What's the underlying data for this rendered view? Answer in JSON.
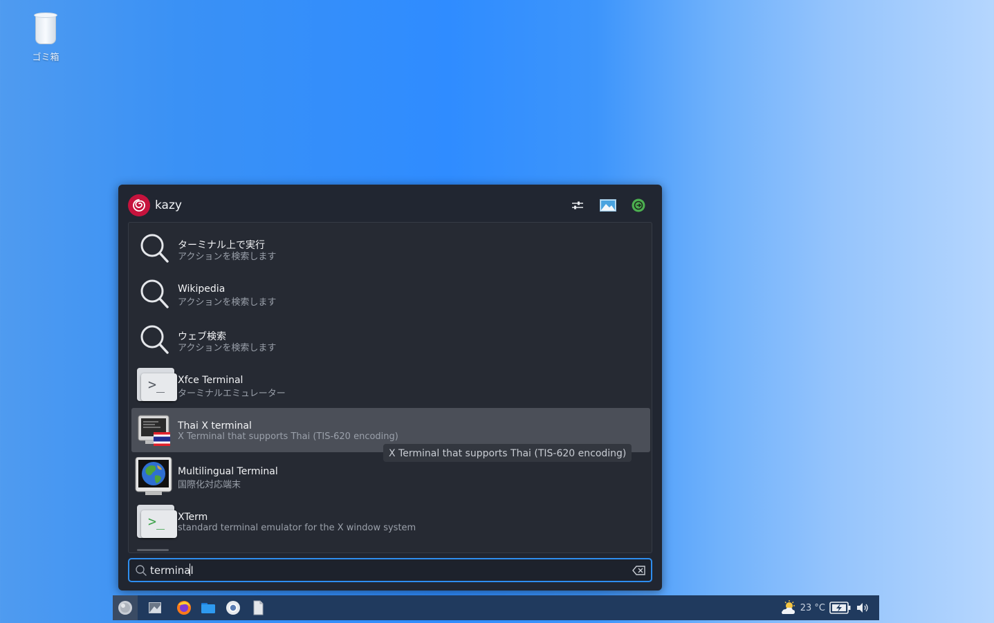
{
  "desktop": {
    "icons": [
      {
        "label": "ゴミ箱",
        "icon": "trash-icon"
      }
    ]
  },
  "launcher": {
    "user": {
      "name": "kazy",
      "avatar_icon": "debian-swirl-icon"
    },
    "header_buttons": [
      {
        "name": "settings",
        "icon": "sliders-icon"
      },
      {
        "name": "lock-screen",
        "icon": "screen-lock-icon"
      },
      {
        "name": "logout",
        "icon": "logout-icon"
      }
    ],
    "results": [
      {
        "title": "ターミナル上で実行",
        "subtitle": "アクションを検索します",
        "icon": "search-icon"
      },
      {
        "title": "Wikipedia",
        "subtitle": "アクションを検索します",
        "icon": "search-icon"
      },
      {
        "title": "ウェブ検索",
        "subtitle": "アクションを検索します",
        "icon": "search-icon"
      },
      {
        "title": "Xfce Terminal",
        "subtitle": "ターミナルエミュレーター",
        "icon": "terminal-icon"
      },
      {
        "title": "Thai X terminal",
        "subtitle": "X Terminal that supports Thai (TIS-620 encoding)",
        "icon": "thai-terminal-icon",
        "selected": true
      },
      {
        "title": "Multilingual Terminal",
        "subtitle": "国際化対応端末",
        "icon": "globe-terminal-icon"
      },
      {
        "title": "XTerm",
        "subtitle": "standard terminal emulator for the X window system",
        "icon": "terminal-icon"
      }
    ],
    "tooltip": "X Terminal that supports Thai (TIS-620 encoding)",
    "search": {
      "value": "terminal",
      "placeholder": ""
    }
  },
  "taskbar": {
    "items": [
      {
        "name": "start-menu",
        "icon": "start-orb-icon"
      },
      {
        "name": "show-desktop",
        "icon": "desktop-icon"
      },
      {
        "name": "firefox",
        "icon": "firefox-icon"
      },
      {
        "name": "file-manager",
        "icon": "folder-icon"
      },
      {
        "name": "browser",
        "icon": "chromium-icon"
      },
      {
        "name": "text-editor",
        "icon": "document-icon"
      }
    ],
    "tray": {
      "weather": "23 °C",
      "weather_icon": "partly-cloudy-icon",
      "battery_icon": "battery-charging-icon",
      "volume_icon": "volume-icon"
    }
  },
  "colors": {
    "accent": "#2e8ef0",
    "selected_row": "#4b4f58",
    "panel_bg": "#212631",
    "logout_green": "#4caf50",
    "avatar_red": "#c6133d"
  }
}
